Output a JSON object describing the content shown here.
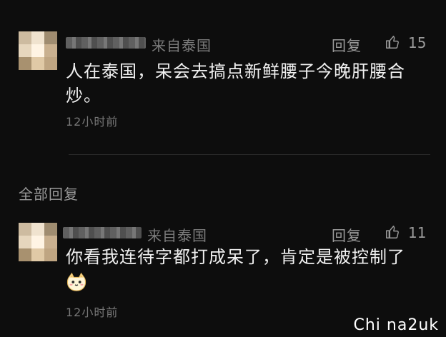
{
  "comment1": {
    "location": "来自泰国",
    "reply_label": "回复",
    "like_count": "15",
    "text_line1": "人在泰国，呆会去搞点新鲜腰子今晚肝腰合",
    "text_line2": "炒。",
    "time": "12小时前"
  },
  "section": {
    "title": "全部回复"
  },
  "comment2": {
    "location": "来自泰国",
    "reply_label": "回复",
    "like_count": "11",
    "text_line1": "你看我连待字都打成呆了，肯定是被控制了",
    "emoji": "cat-face-emoji",
    "time": "12小时前"
  },
  "watermark": "Chi na2uk",
  "colors": {
    "background": "#0d0d0d",
    "text": "#f0f0f0",
    "muted": "#7b7b7b"
  }
}
